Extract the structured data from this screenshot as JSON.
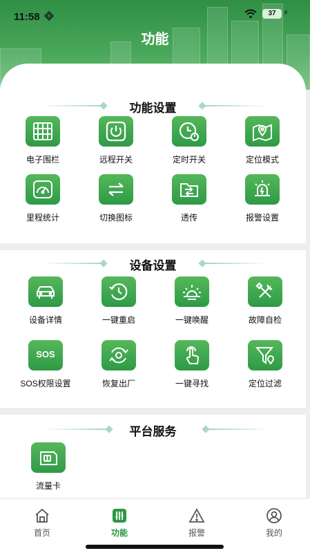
{
  "status": {
    "time": "11:58",
    "battery": "37"
  },
  "title": "功能",
  "sections": [
    {
      "title": "功能设置",
      "items": [
        {
          "label": "电子围栏",
          "icon": "fence-icon"
        },
        {
          "label": "远程开关",
          "icon": "power-icon"
        },
        {
          "label": "定时开关",
          "icon": "timer-power-icon"
        },
        {
          "label": "定位模式",
          "icon": "map-pin-icon"
        },
        {
          "label": "里程统计",
          "icon": "speedometer-icon"
        },
        {
          "label": "切换图标",
          "icon": "swap-arrows-icon"
        },
        {
          "label": "透传",
          "icon": "transparent-transfer-icon"
        },
        {
          "label": "报警设置",
          "icon": "siren-icon"
        }
      ]
    },
    {
      "title": "设备设置",
      "items": [
        {
          "label": "设备详情",
          "icon": "car-icon"
        },
        {
          "label": "一键重启",
          "icon": "restart-clock-icon"
        },
        {
          "label": "一键唤醒",
          "icon": "sunrise-icon"
        },
        {
          "label": "故障自检",
          "icon": "tools-icon"
        },
        {
          "label": "SOS权限设置",
          "icon": "sos-icon",
          "badge": "SOS"
        },
        {
          "label": "恢复出厂",
          "icon": "reset-gear-icon"
        },
        {
          "label": "一键寻找",
          "icon": "tap-hand-icon"
        },
        {
          "label": "定位过滤",
          "icon": "filter-pin-icon"
        }
      ]
    },
    {
      "title": "平台服务",
      "items": [
        {
          "label": "流量卡",
          "icon": "sim-card-icon"
        }
      ]
    }
  ],
  "tabs": [
    {
      "label": "首页",
      "icon": "home-icon"
    },
    {
      "label": "功能",
      "icon": "function-sliders-icon",
      "active": true
    },
    {
      "label": "报警",
      "icon": "warning-triangle-icon"
    },
    {
      "label": "我的",
      "icon": "user-icon"
    }
  ],
  "colors": {
    "accent": "#2a9a45",
    "icon_bg_top": "#55b75a",
    "icon_bg_bottom": "#2e9a47"
  }
}
